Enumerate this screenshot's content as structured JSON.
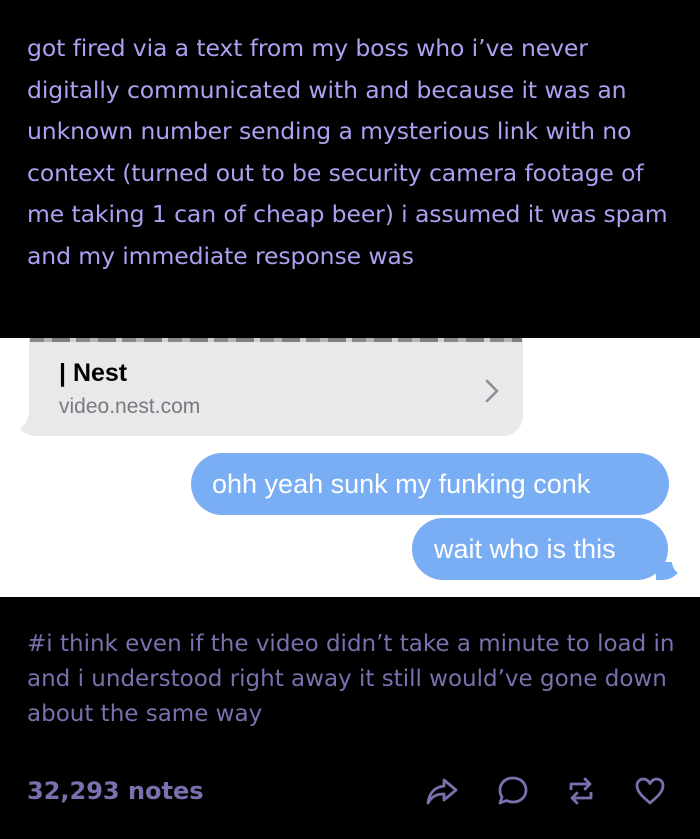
{
  "post": {
    "body": "got fired via a text from my boss who i’ve never digitally communicated with and because it was an unknown number sending a mysterious link with no context (turned out to be security camera footage of me taking 1 can of cheap beer) i assumed it was spam and my immediate response was"
  },
  "screenshot": {
    "link_card": {
      "title": "| Nest",
      "url": "video.nest.com"
    },
    "messages": [
      {
        "text": "ohh yeah sunk my funking conk"
      },
      {
        "text": "wait who is this"
      }
    ]
  },
  "tags": "#i think even if the video didn’t take a minute to load in and i understood right away it still would’ve gone down about the same way",
  "footer": {
    "notes": "32,293 notes",
    "actions": [
      "share-icon",
      "reply-icon",
      "reblog-icon",
      "like-icon"
    ]
  },
  "colors": {
    "background": "#000000",
    "post_text": "#b09ff0",
    "muted_text": "#7b6fad",
    "sent_bubble": "#7aaef4",
    "received_bubble": "#e9e9eb"
  }
}
